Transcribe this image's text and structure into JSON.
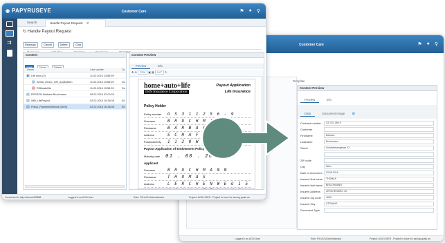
{
  "back_window": {
    "app_title": "Customer Care",
    "tabs": [
      "Overview",
      "Activities",
      "Content",
      "Designer",
      "Template"
    ],
    "preview_title": "Content Preview",
    "preview_tabs": [
      "Preview",
      "Info"
    ],
    "subtabs": [
      "Data",
      "Document Image"
    ],
    "fields": [
      {
        "label": "Contract number",
        "value": "GS 311 256-9"
      },
      {
        "label": "Customer",
        "value": ""
      },
      {
        "label": "Firstname",
        "value": "Barbara"
      },
      {
        "label": "Lastname",
        "value": "Bruchmann"
      },
      {
        "label": "Street",
        "value": "Schafwiesengasse 12"
      },
      {
        "label": "",
        "value": ""
      },
      {
        "label": "ZIP code",
        "value": ""
      },
      {
        "label": "City",
        "value": "Wien"
      },
      {
        "label": "Date of document",
        "value": "03.08.2016"
      },
      {
        "label": "Insured first name",
        "value": "THOMAS"
      },
      {
        "label": "Insured last name",
        "value": "BRUCHMANN"
      },
      {
        "label": "Insured Address",
        "value": "LERCHENWEG 15"
      },
      {
        "label": "Insured Zip code",
        "value": "4600"
      },
      {
        "label": "Insured City",
        "value": "ATTNANG"
      },
      {
        "label": "Document Type",
        "value": ""
      }
    ],
    "status": {
      "user": "Logged in as ACM User",
      "role": "Role: PM ACM Administrator",
      "project": "Project: ACM USER - Project to have for saving goals as"
    }
  },
  "front_window": {
    "logo": "PAPYRUSEYE",
    "app_title": "Customer Care",
    "search_tab": "Search",
    "request_tab": "Handle Payout Request",
    "heading": "Handle Payout Request",
    "actions": [
      "Reassign",
      "Cancel",
      "Delete",
      "Chat"
    ],
    "tabs": [
      "Overview",
      "Activities",
      "Content",
      "Designer",
      "Template"
    ],
    "content_title": "Content",
    "content_buttons": [
      "Add",
      "Move",
      "Delete"
    ],
    "columns": [
      "Name",
      "Last update",
      "Ty"
    ],
    "rows": [
      {
        "name": "Life docs (2)",
        "date": "11.02.2016 13:55:59",
        "type": "",
        "selected": false
      },
      {
        "name": "Aetna_Group_Life_Application",
        "date": "11.02.2016 13:55:59",
        "type": "Do",
        "selected": false
      },
      {
        "name": "R36/satellite",
        "date": "11.02.2016 13:55:59",
        "type": "Do",
        "selected": false
      },
      {
        "name": "PERSON Barbara Bruchmann",
        "date": "09.02.2016 02:00:29",
        "type": "",
        "selected": false
      },
      {
        "name": "IMB_LifePayout",
        "date": "02.02.2016 16:36:08",
        "type": "Ed",
        "selected": false
      },
      {
        "name": "Policy_PaymentOfWord (DMS)",
        "date": "02.02.2016 16:36:08",
        "type": "Ed",
        "selected": true
      }
    ],
    "preview_title": "Content Preview",
    "preview_tabs": [
      "Preview",
      "Info"
    ],
    "subtabs": [
      "Data",
      "Document Image"
    ],
    "zoom": "72%",
    "page_field": "0.0°",
    "doc": {
      "brand": "home+auto+life",
      "brand_sub": "ISIS Insurance Corporation",
      "doc_title1": "Payout Application",
      "doc_title2": "Life Insurance",
      "policy_holder": "Policy Holder",
      "ph_fields": [
        {
          "label": "Policy number",
          "value": "G S 3 1 1 2 5 6 - 9"
        },
        {
          "label": "Surname",
          "value": "B R U C H M A N N"
        },
        {
          "label": "Firstname",
          "value": "B A R B A R A"
        },
        {
          "label": "Address",
          "value": "S C H A F W I E S E N"
        },
        {
          "label": "Postcode/City",
          "value": "1 1 2 0      W I E N"
        }
      ],
      "section2": "Payout Application of Endowment Policy with partial maturity",
      "maturity_label": "Maturity date",
      "maturity_value": "01 . 08 . 2015",
      "applicant": "Applicant",
      "ap_fields": [
        {
          "label": "Surname",
          "value": "B R U C H M A N N"
        },
        {
          "label": "Firstname",
          "value": "T H O M A S"
        },
        {
          "label": "Address",
          "value": "L E R C H E N W E G  1 5"
        },
        {
          "label": "Postcode/City",
          "value": "4 6 0 0    A T T N A N G"
        }
      ]
    },
    "status": {
      "connected": "Connected to http://demo4/E8888",
      "user": "Logged in as ACM User",
      "role": "Role: PM ACM Administrator",
      "project": "Project: ACM USER - Project to have for saving goals as"
    }
  },
  "arrow_color": "#5f8a7e"
}
